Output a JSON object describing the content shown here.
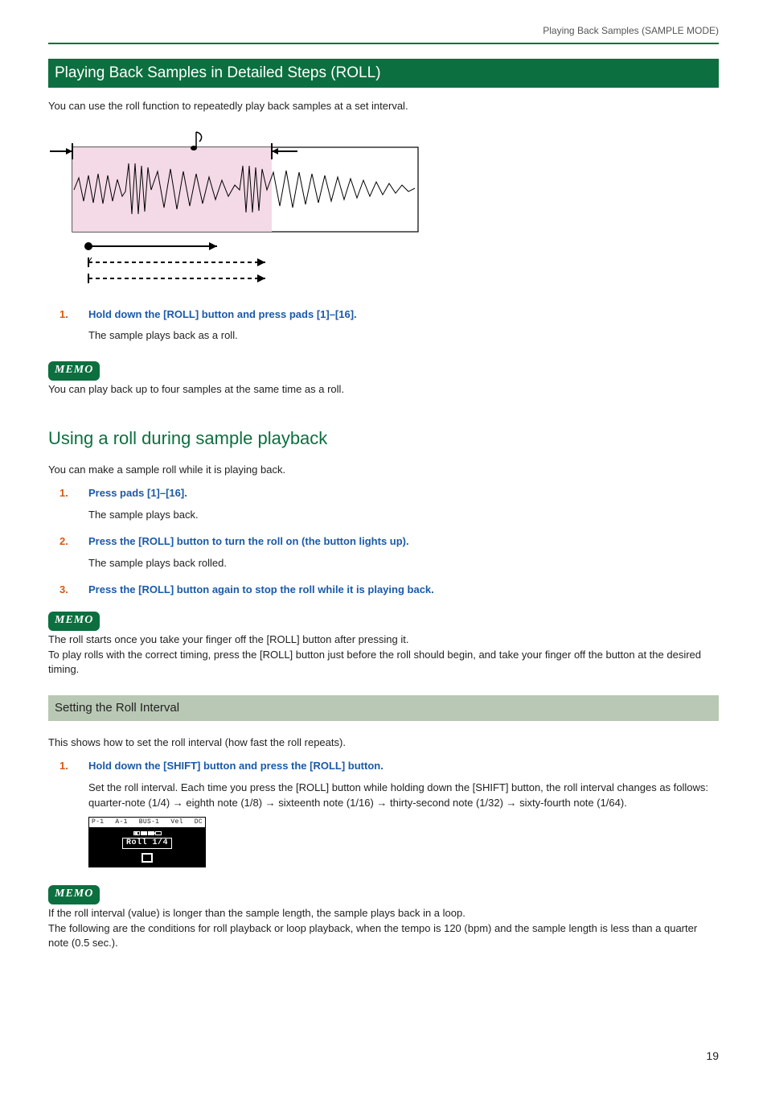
{
  "header": {
    "breadcrumb": "Playing Back Samples (SAMPLE MODE)"
  },
  "section1": {
    "title": "Playing Back Samples in Detailed Steps (ROLL)",
    "intro": "You can use the roll function to repeatedly play back samples at a set interval.",
    "steps": [
      {
        "num": "1.",
        "title": "Hold down the [ROLL] button and press pads [1]–[16].",
        "body": "The sample plays back as a roll."
      }
    ],
    "memo_label": "MEMO",
    "memo_text": "You can play back up to four samples at the same time as a roll."
  },
  "section2": {
    "title": "Using a roll during sample playback",
    "intro": "You can make a sample roll while it is playing back.",
    "steps": [
      {
        "num": "1.",
        "title": "Press pads [1]–[16].",
        "body": "The sample plays back."
      },
      {
        "num": "2.",
        "title": "Press the [ROLL] button to turn the roll on (the button lights up).",
        "body": "The sample plays back rolled."
      },
      {
        "num": "3.",
        "title": "Press the [ROLL] button again to stop the roll while it is playing back.",
        "body": ""
      }
    ],
    "memo_label": "MEMO",
    "memo_text": "The roll starts once you take your finger off the [ROLL] button after pressing it.\nTo play rolls with the correct timing, press the [ROLL] button just before the roll should begin, and take your finger off the button at the desired timing."
  },
  "section3": {
    "title": "Setting the Roll Interval",
    "intro": "This shows how to set the roll interval (how fast the roll repeats).",
    "steps": [
      {
        "num": "1.",
        "title": "Hold down the [SHIFT] button and press the [ROLL] button.",
        "body": "Set the roll interval. Each time you press the [ROLL] button while holding down the [SHIFT] button, the roll interval changes as follows: quarter-note (1/4) → eighth note (1/8) → sixteenth note (1/16) → thirty-second note (1/32) → sixty-fourth note (1/64)."
      }
    ],
    "lcd": {
      "top": [
        "P-1",
        "A-1",
        "BUS-1",
        "Vel",
        "DC"
      ],
      "roll_label": "Roll 1/4"
    },
    "memo_label": "MEMO",
    "memo_text": "If the roll interval (value) is longer than the sample length, the sample plays back in a loop.\nThe following are the conditions for roll playback or loop playback, when the tempo is 120 (bpm) and the sample length is less than a quarter note (0.5 sec.)."
  },
  "page_number": "19"
}
